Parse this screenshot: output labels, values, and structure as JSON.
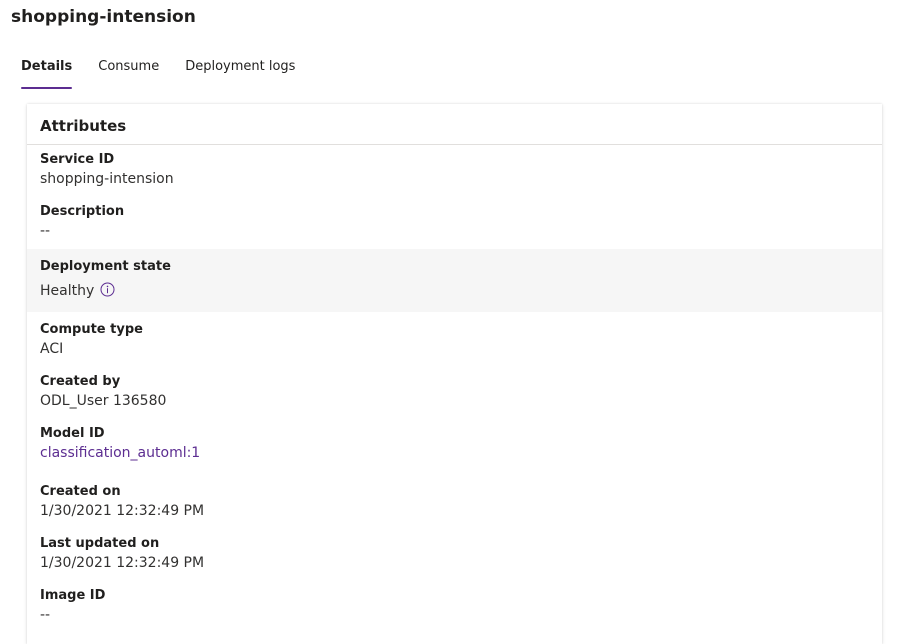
{
  "page": {
    "title": "shopping-intension"
  },
  "tabs": [
    {
      "label": "Details",
      "active": true
    },
    {
      "label": "Consume",
      "active": false
    },
    {
      "label": "Deployment logs",
      "active": false
    }
  ],
  "card": {
    "title": "Attributes",
    "attributes": [
      {
        "label": "Service ID",
        "value": "shopping-intension"
      },
      {
        "label": "Description",
        "value": "--"
      },
      {
        "label": "Deployment state",
        "value": "Healthy",
        "icon": "info-icon"
      },
      {
        "label": "Compute type",
        "value": "ACI"
      },
      {
        "label": "Created by",
        "value": "ODL_User 136580"
      },
      {
        "label": "Model ID",
        "value": "classification_automl:1",
        "is_link": true
      },
      {
        "label": "Created on",
        "value": "1/30/2021 12:32:49 PM"
      },
      {
        "label": "Last updated on",
        "value": "1/30/2021 12:32:49 PM"
      },
      {
        "label": "Image ID",
        "value": "--"
      }
    ]
  },
  "colors": {
    "accent": "#5c2d91",
    "shaded_row": "#f6f6f6"
  }
}
